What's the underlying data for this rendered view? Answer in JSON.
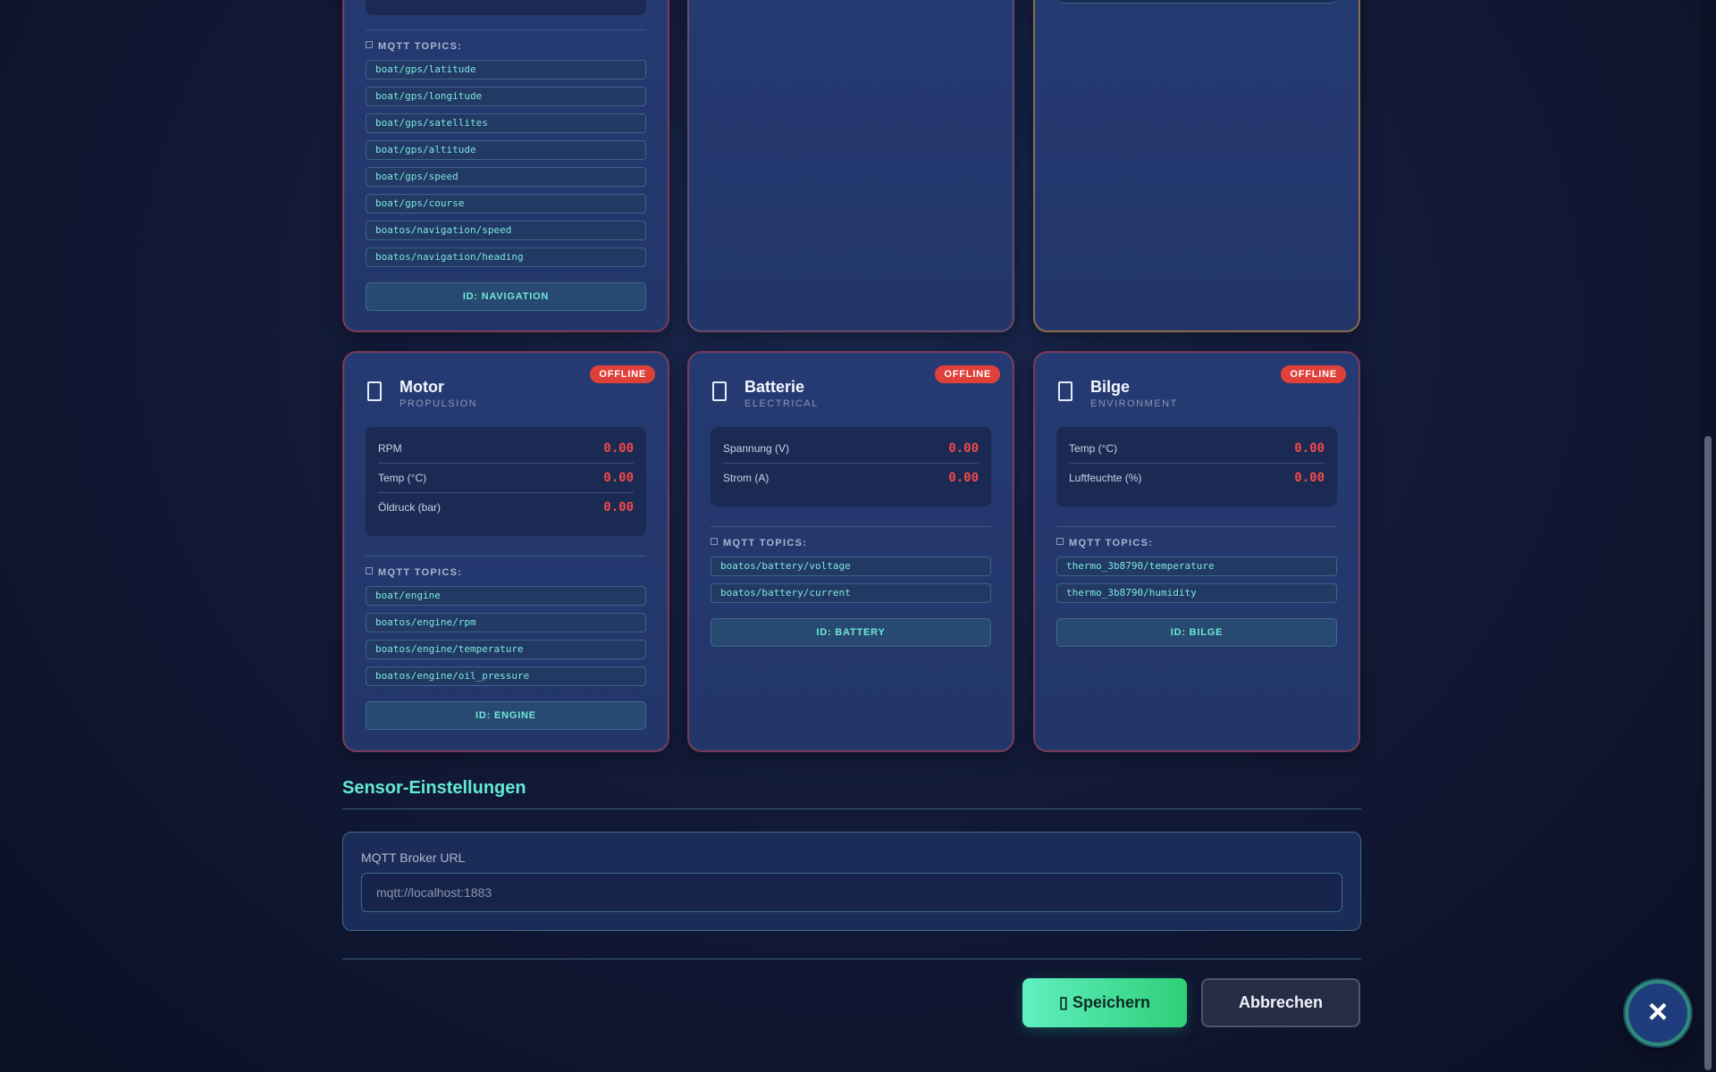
{
  "navigation_card": {
    "topics_label": "MQTT TOPICS:",
    "topics": [
      "boat/gps/latitude",
      "boat/gps/longitude",
      "boat/gps/satellites",
      "boat/gps/altitude",
      "boat/gps/speed",
      "boat/gps/course",
      "boatos/navigation/speed",
      "boatos/navigation/heading"
    ],
    "id_label": "ID: NAVIGATION"
  },
  "engine_card": {
    "title": "Motor",
    "subtitle": "PROPULSION",
    "status": "OFFLINE",
    "readings": [
      {
        "label": "RPM",
        "value": "0.00"
      },
      {
        "label": "Temp (°C)",
        "value": "0.00"
      },
      {
        "label": "Öldruck (bar)",
        "value": "0.00"
      }
    ],
    "topics_label": "MQTT TOPICS:",
    "topics": [
      "boat/engine",
      "boatos/engine/rpm",
      "boatos/engine/temperature",
      "boatos/engine/oil_pressure"
    ],
    "id_label": "ID: ENGINE"
  },
  "battery_card": {
    "title": "Batterie",
    "subtitle": "ELECTRICAL",
    "status": "OFFLINE",
    "readings": [
      {
        "label": "Spannung (V)",
        "value": "0.00"
      },
      {
        "label": "Strom (A)",
        "value": "0.00"
      }
    ],
    "topics_label": "MQTT TOPICS:",
    "topics": [
      "boatos/battery/voltage",
      "boatos/battery/current"
    ],
    "id_label": "ID: BATTERY"
  },
  "bilge_card": {
    "title": "Bilge",
    "subtitle": "ENVIRONMENT",
    "status": "OFFLINE",
    "readings": [
      {
        "label": "Temp (°C)",
        "value": "0.00"
      },
      {
        "label": "Luftfeuchte (%)",
        "value": "0.00"
      }
    ],
    "topics_label": "MQTT TOPICS:",
    "topics": [
      "thermo_3b8790/temperature",
      "thermo_3b8790/humidity"
    ],
    "id_label": "ID: BILGE"
  },
  "settings": {
    "section_title": "Sensor-Einstellungen",
    "broker_label": "MQTT Broker URL",
    "broker_placeholder": "mqtt://localhost:1883",
    "broker_value": ""
  },
  "actions": {
    "save_label": "▯ Speichern",
    "cancel_label": "Abbrechen",
    "close_icon": "×"
  },
  "colors": {
    "accent_teal": "#62ead6",
    "offline_red": "#e0403a",
    "value_red": "#f0484a",
    "save_green": "#2fcf78"
  }
}
